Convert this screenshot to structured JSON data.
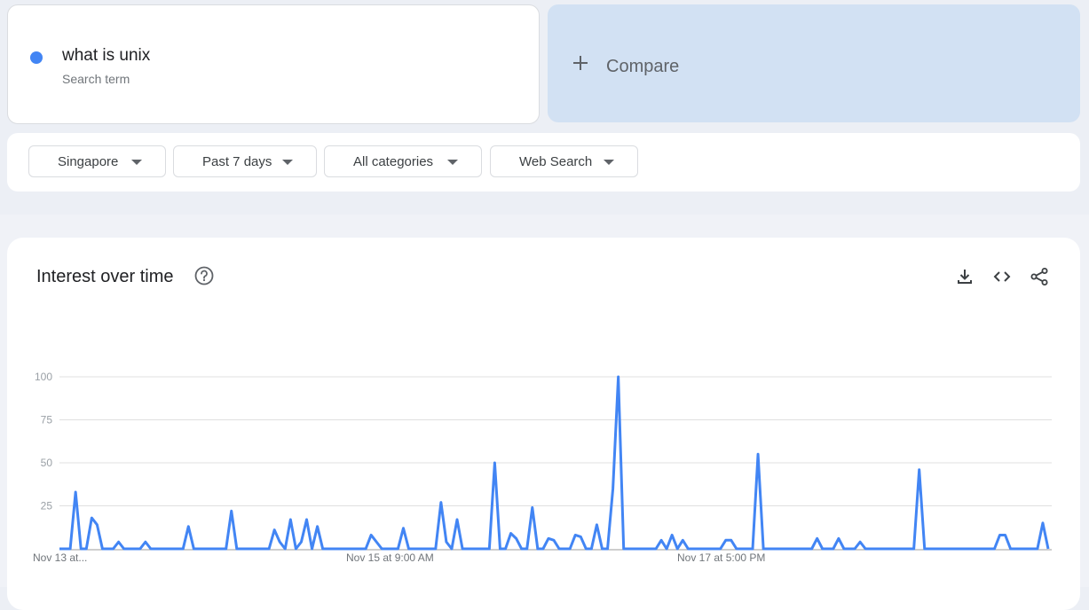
{
  "search_term": {
    "name": "what is unix",
    "type": "Search term",
    "color": "#4285f4"
  },
  "compare": {
    "label": "Compare",
    "icon": "plus-icon"
  },
  "filters": [
    {
      "label": "Singapore",
      "icon": "caret-down-icon"
    },
    {
      "label": "Past 7 days",
      "icon": "caret-down-icon"
    },
    {
      "label": "All categories",
      "icon": "caret-down-icon"
    },
    {
      "label": "Web Search",
      "icon": "caret-down-icon"
    }
  ],
  "chart_panel": {
    "title": "Interest over time",
    "icons": [
      "help-icon",
      "download-icon",
      "embed-icon",
      "share-icon"
    ]
  },
  "chart_data": {
    "type": "line",
    "series": [
      {
        "color": "#4285f4",
        "values": [
          0,
          0,
          0,
          33,
          0,
          0,
          18,
          14,
          0,
          0,
          0,
          4,
          0,
          0,
          0,
          0,
          4,
          0,
          0,
          0,
          0,
          0,
          0,
          0,
          13,
          0,
          0,
          0,
          0,
          0,
          0,
          0,
          22,
          0,
          0,
          0,
          0,
          0,
          0,
          0,
          11,
          4,
          0,
          17,
          0,
          4,
          17,
          0,
          13,
          0,
          0,
          0,
          0,
          0,
          0,
          0,
          0,
          0,
          8,
          4,
          0,
          0,
          0,
          0,
          12,
          0,
          0,
          0,
          0,
          0,
          0,
          27,
          4,
          0,
          17,
          0,
          0,
          0,
          0,
          0,
          0,
          50,
          0,
          0,
          9,
          6,
          0,
          0,
          24,
          0,
          0,
          6,
          5,
          0,
          0,
          0,
          8,
          7,
          0,
          0,
          14,
          0,
          0,
          35,
          100,
          0,
          0,
          0,
          0,
          0,
          0,
          0,
          5,
          0,
          8,
          0,
          5,
          0,
          0,
          0,
          0,
          0,
          0,
          0,
          5,
          5,
          0,
          0,
          0,
          0,
          55,
          0,
          0,
          0,
          0,
          0,
          0,
          0,
          0,
          0,
          0,
          6,
          0,
          0,
          0,
          6,
          0,
          0,
          0,
          4,
          0,
          0,
          0,
          0,
          0,
          0,
          0,
          0,
          0,
          0,
          46,
          0,
          0,
          0,
          0,
          0,
          0,
          0,
          0,
          0,
          0,
          0,
          0,
          0,
          0,
          8,
          8,
          0,
          0,
          0,
          0,
          0,
          0,
          15,
          0
        ]
      }
    ],
    "ylim": [
      0,
      100
    ],
    "y_ticks": [
      "100",
      "75",
      "50",
      "25"
    ],
    "x_tick_labels": [
      "Nov 13 at...",
      "Nov 15 at 9:00 AM",
      "Nov 17 at 5:00 PM"
    ],
    "grid": true
  }
}
